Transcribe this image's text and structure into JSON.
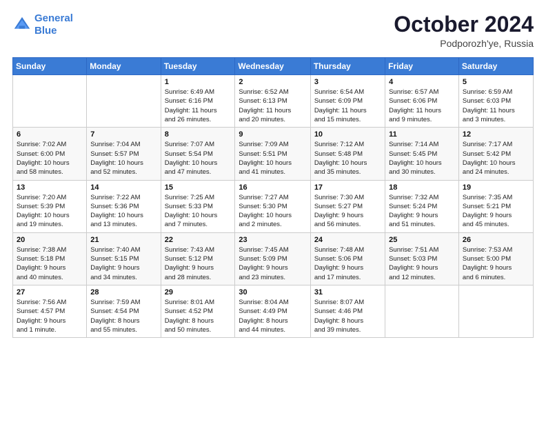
{
  "header": {
    "logo_line1": "General",
    "logo_line2": "Blue",
    "month": "October 2024",
    "location": "Podporozh'ye, Russia"
  },
  "weekdays": [
    "Sunday",
    "Monday",
    "Tuesday",
    "Wednesday",
    "Thursday",
    "Friday",
    "Saturday"
  ],
  "weeks": [
    [
      {
        "day": "",
        "text": ""
      },
      {
        "day": "",
        "text": ""
      },
      {
        "day": "1",
        "text": "Sunrise: 6:49 AM\nSunset: 6:16 PM\nDaylight: 11 hours\nand 26 minutes."
      },
      {
        "day": "2",
        "text": "Sunrise: 6:52 AM\nSunset: 6:13 PM\nDaylight: 11 hours\nand 20 minutes."
      },
      {
        "day": "3",
        "text": "Sunrise: 6:54 AM\nSunset: 6:09 PM\nDaylight: 11 hours\nand 15 minutes."
      },
      {
        "day": "4",
        "text": "Sunrise: 6:57 AM\nSunset: 6:06 PM\nDaylight: 11 hours\nand 9 minutes."
      },
      {
        "day": "5",
        "text": "Sunrise: 6:59 AM\nSunset: 6:03 PM\nDaylight: 11 hours\nand 3 minutes."
      }
    ],
    [
      {
        "day": "6",
        "text": "Sunrise: 7:02 AM\nSunset: 6:00 PM\nDaylight: 10 hours\nand 58 minutes."
      },
      {
        "day": "7",
        "text": "Sunrise: 7:04 AM\nSunset: 5:57 PM\nDaylight: 10 hours\nand 52 minutes."
      },
      {
        "day": "8",
        "text": "Sunrise: 7:07 AM\nSunset: 5:54 PM\nDaylight: 10 hours\nand 47 minutes."
      },
      {
        "day": "9",
        "text": "Sunrise: 7:09 AM\nSunset: 5:51 PM\nDaylight: 10 hours\nand 41 minutes."
      },
      {
        "day": "10",
        "text": "Sunrise: 7:12 AM\nSunset: 5:48 PM\nDaylight: 10 hours\nand 35 minutes."
      },
      {
        "day": "11",
        "text": "Sunrise: 7:14 AM\nSunset: 5:45 PM\nDaylight: 10 hours\nand 30 minutes."
      },
      {
        "day": "12",
        "text": "Sunrise: 7:17 AM\nSunset: 5:42 PM\nDaylight: 10 hours\nand 24 minutes."
      }
    ],
    [
      {
        "day": "13",
        "text": "Sunrise: 7:20 AM\nSunset: 5:39 PM\nDaylight: 10 hours\nand 19 minutes."
      },
      {
        "day": "14",
        "text": "Sunrise: 7:22 AM\nSunset: 5:36 PM\nDaylight: 10 hours\nand 13 minutes."
      },
      {
        "day": "15",
        "text": "Sunrise: 7:25 AM\nSunset: 5:33 PM\nDaylight: 10 hours\nand 7 minutes."
      },
      {
        "day": "16",
        "text": "Sunrise: 7:27 AM\nSunset: 5:30 PM\nDaylight: 10 hours\nand 2 minutes."
      },
      {
        "day": "17",
        "text": "Sunrise: 7:30 AM\nSunset: 5:27 PM\nDaylight: 9 hours\nand 56 minutes."
      },
      {
        "day": "18",
        "text": "Sunrise: 7:32 AM\nSunset: 5:24 PM\nDaylight: 9 hours\nand 51 minutes."
      },
      {
        "day": "19",
        "text": "Sunrise: 7:35 AM\nSunset: 5:21 PM\nDaylight: 9 hours\nand 45 minutes."
      }
    ],
    [
      {
        "day": "20",
        "text": "Sunrise: 7:38 AM\nSunset: 5:18 PM\nDaylight: 9 hours\nand 40 minutes."
      },
      {
        "day": "21",
        "text": "Sunrise: 7:40 AM\nSunset: 5:15 PM\nDaylight: 9 hours\nand 34 minutes."
      },
      {
        "day": "22",
        "text": "Sunrise: 7:43 AM\nSunset: 5:12 PM\nDaylight: 9 hours\nand 28 minutes."
      },
      {
        "day": "23",
        "text": "Sunrise: 7:45 AM\nSunset: 5:09 PM\nDaylight: 9 hours\nand 23 minutes."
      },
      {
        "day": "24",
        "text": "Sunrise: 7:48 AM\nSunset: 5:06 PM\nDaylight: 9 hours\nand 17 minutes."
      },
      {
        "day": "25",
        "text": "Sunrise: 7:51 AM\nSunset: 5:03 PM\nDaylight: 9 hours\nand 12 minutes."
      },
      {
        "day": "26",
        "text": "Sunrise: 7:53 AM\nSunset: 5:00 PM\nDaylight: 9 hours\nand 6 minutes."
      }
    ],
    [
      {
        "day": "27",
        "text": "Sunrise: 7:56 AM\nSunset: 4:57 PM\nDaylight: 9 hours\nand 1 minute."
      },
      {
        "day": "28",
        "text": "Sunrise: 7:59 AM\nSunset: 4:54 PM\nDaylight: 8 hours\nand 55 minutes."
      },
      {
        "day": "29",
        "text": "Sunrise: 8:01 AM\nSunset: 4:52 PM\nDaylight: 8 hours\nand 50 minutes."
      },
      {
        "day": "30",
        "text": "Sunrise: 8:04 AM\nSunset: 4:49 PM\nDaylight: 8 hours\nand 44 minutes."
      },
      {
        "day": "31",
        "text": "Sunrise: 8:07 AM\nSunset: 4:46 PM\nDaylight: 8 hours\nand 39 minutes."
      },
      {
        "day": "",
        "text": ""
      },
      {
        "day": "",
        "text": ""
      }
    ]
  ]
}
